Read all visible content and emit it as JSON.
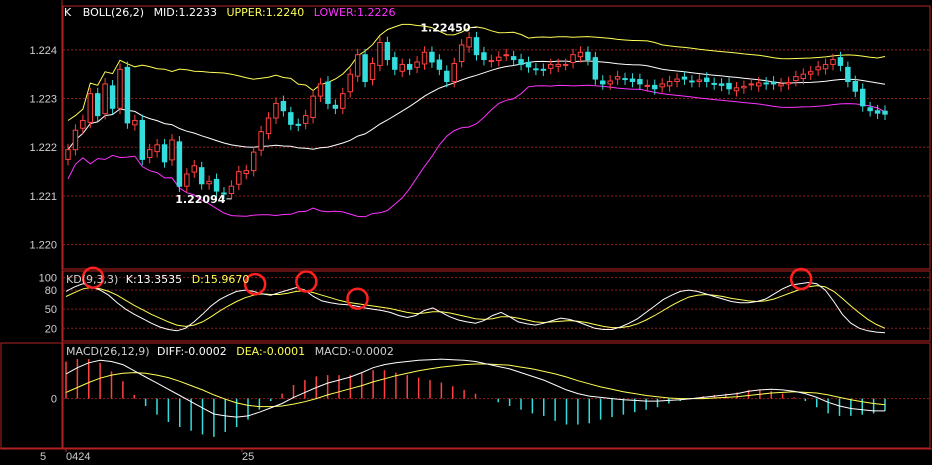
{
  "colors": {
    "background": "#000000",
    "frame": "#b22222",
    "grid": "#8b1a1a",
    "up": "#ff4040",
    "down": "#33dddd",
    "mid": "#ffffff",
    "upper": "#ffff55",
    "lower": "#ff33ff",
    "k": "#ffffff",
    "d": "#ffff55",
    "diff": "#ffffff",
    "dea": "#ffff55",
    "marker": "#ff2020"
  },
  "chart_data": [
    {
      "type": "candlestick",
      "panel": "price",
      "indicator": {
        "prefix": "K",
        "name": "BOLL(26,2)",
        "mid_label": "MID:",
        "mid_value": "1.2233",
        "upper_label": "UPPER:",
        "upper_value": "1.2240",
        "lower_label": "LOWER:",
        "lower_value": "1.2226"
      },
      "yticks": [
        "1.224",
        "1.223",
        "1.222",
        "1.221",
        "1.220"
      ],
      "ytick_values": [
        1.224,
        1.223,
        1.222,
        1.221,
        1.22
      ],
      "ylim": [
        1.2195,
        1.2249
      ],
      "annotations": [
        {
          "text": "1.22450",
          "x_index": 55,
          "value": 1.2245,
          "side": "left"
        },
        {
          "text": "1.22094",
          "x_index": 22,
          "value": 1.22094,
          "side": "left"
        }
      ],
      "closes": [
        1.22195,
        1.22235,
        1.22255,
        1.2231,
        1.22265,
        1.2233,
        1.2228,
        1.2236,
        1.2225,
        1.22255,
        1.22175,
        1.22195,
        1.22205,
        1.2217,
        1.22215,
        1.2212,
        1.22145,
        1.22162,
        1.22125,
        1.2213,
        1.2211,
        1.22105,
        1.2212,
        1.2215,
        1.22152,
        1.2219,
        1.22232,
        1.2226,
        1.2229,
        1.22275,
        1.22247,
        1.22245,
        1.22265,
        1.22305,
        1.2233,
        1.2229,
        1.2228,
        1.2231,
        1.2235,
        1.2239,
        1.22335,
        1.22372,
        1.22415,
        1.2238,
        1.2236,
        1.2237,
        1.2236,
        1.22375,
        1.22395,
        1.22375,
        1.2236,
        1.22335,
        1.22372,
        1.2241,
        1.22425,
        1.2239,
        1.2238,
        1.22378,
        1.22385,
        1.2239,
        1.2238,
        1.2237,
        1.22365,
        1.2236,
        1.22358,
        1.2237,
        1.2237,
        1.2237,
        1.2239,
        1.22395,
        1.2238,
        1.2234,
        1.2233,
        1.22336,
        1.22345,
        1.2234,
        1.22335,
        1.2233,
        1.22327,
        1.2232,
        1.2233,
        1.22335,
        1.2234,
        1.2234,
        1.22335,
        1.22338,
        1.22335,
        1.2233,
        1.22327,
        1.2232,
        1.22322,
        1.22325,
        1.2233,
        1.22332,
        1.2233,
        1.2233,
        1.2233,
        1.22333,
        1.22345,
        1.2235,
        1.22355,
        1.22365,
        1.2237,
        1.2238,
        1.22368,
        1.22335,
        1.22315,
        1.22285,
        1.22275,
        1.2227,
        1.22268
      ]
    },
    {
      "type": "line",
      "panel": "kd",
      "indicator": {
        "name": "KD(9,3,3)",
        "k_label": "K:",
        "k_value": "13.3535",
        "d_label": "D:",
        "d_value": "15.9670"
      },
      "yticks": [
        "100",
        "80",
        "50",
        "20"
      ],
      "ytick_values": [
        100,
        80,
        50,
        20
      ],
      "ylim": [
        0,
        110
      ],
      "k": [
        78,
        85,
        90,
        85,
        80,
        72,
        60,
        50,
        42,
        35,
        28,
        22,
        18,
        16,
        20,
        30,
        42,
        55,
        65,
        72,
        78,
        80,
        78,
        74,
        72,
        76,
        80,
        84,
        80,
        70,
        63,
        60,
        58,
        57,
        55,
        52,
        50,
        48,
        45,
        40,
        37,
        40,
        48,
        52,
        45,
        38,
        33,
        30,
        28,
        32,
        40,
        45,
        38,
        30,
        27,
        25,
        28,
        32,
        36,
        34,
        30,
        25,
        20,
        18,
        18,
        22,
        28,
        35,
        45,
        55,
        65,
        72,
        78,
        80,
        78,
        74,
        70,
        66,
        62,
        60,
        60,
        62,
        66,
        74,
        82,
        88,
        90,
        92,
        90,
        80,
        62,
        42,
        28,
        20,
        16,
        14,
        13
      ],
      "d": [
        70,
        76,
        82,
        84,
        82,
        78,
        72,
        64,
        56,
        49,
        42,
        36,
        30,
        25,
        23,
        25,
        30,
        38,
        47,
        55,
        62,
        68,
        72,
        74,
        73,
        73,
        75,
        78,
        79,
        76,
        72,
        68,
        64,
        61,
        59,
        57,
        55,
        53,
        51,
        48,
        45,
        43,
        44,
        46,
        46,
        44,
        41,
        38,
        35,
        34,
        35,
        38,
        38,
        36,
        33,
        30,
        29,
        30,
        31,
        32,
        31,
        29,
        26,
        23,
        21,
        21,
        23,
        27,
        33,
        40,
        48,
        56,
        63,
        69,
        72,
        73,
        72,
        70,
        67,
        65,
        63,
        62,
        63,
        66,
        71,
        76,
        81,
        85,
        87,
        85,
        78,
        67,
        55,
        44,
        34,
        26,
        20
      ]
    },
    {
      "type": "bar",
      "panel": "macd",
      "indicator": {
        "name": "MACD(26,12,9)",
        "diff_label": "DIFF:",
        "diff_value": "-0.0002",
        "dea_label": "DEA:",
        "dea_value": "-0.0001",
        "macd_label": "MACD:",
        "macd_value": "-0.0002"
      },
      "yticks": [
        "0"
      ],
      "ytick_values": [
        0
      ],
      "ylim": [
        -0.0008,
        0.0009
      ],
      "diff": [
        0.0004,
        0.0005,
        0.00058,
        0.00062,
        0.0006,
        0.00055,
        0.00045,
        0.00035,
        0.00025,
        0.00015,
        5e-05,
        -5e-05,
        -0.00015,
        -0.00025,
        -0.00028,
        -0.0003,
        -0.00028,
        -0.00022,
        -0.00015,
        -8e-05,
        2e-05,
        0.0001,
        0.00018,
        0.00025,
        0.0003,
        0.00035,
        0.00042,
        0.0005,
        0.00055,
        0.00058,
        0.0006,
        0.00062,
        0.00063,
        0.00064,
        0.00063,
        0.00062,
        0.0006,
        0.00056,
        0.00052,
        0.00048,
        0.00042,
        0.00036,
        0.0003,
        0.00022,
        0.00014,
        8e-05,
        4e-05,
        2e-05,
        0.0,
        -2e-05,
        -3e-05,
        -4e-05,
        -4e-05,
        -3e-05,
        -2e-05,
        0.0,
        2e-05,
        4e-05,
        6e-05,
        8e-05,
        0.00012,
        0.00014,
        0.00015,
        0.00014,
        0.00012,
        8e-05,
        2e-05,
        -6e-05,
        -0.00012,
        -0.00016,
        -0.00018,
        -0.0002,
        -0.0002
      ],
      "dea": [
        0.0001,
        0.00018,
        0.00026,
        0.00033,
        0.00038,
        0.00041,
        0.00042,
        0.00041,
        0.00038,
        0.00034,
        0.00028,
        0.00021,
        0.00014,
        6e-05,
        -1e-05,
        -7e-05,
        -0.00011,
        -0.00013,
        -0.00013,
        -0.00012,
        -9e-05,
        -5e-05,
        0.0,
        6e-05,
        0.00011,
        0.00016,
        0.00021,
        0.00027,
        0.00032,
        0.00037,
        0.00041,
        0.00045,
        0.00048,
        0.00051,
        0.00053,
        0.00055,
        0.00056,
        0.00056,
        0.00055,
        0.00054,
        0.00051,
        0.00048,
        0.00044,
        0.0004,
        0.00035,
        0.00029,
        0.00024,
        0.00019,
        0.00015,
        0.00011,
        8e-05,
        5e-05,
        3e-05,
        1e-05,
        0.0,
        0.0,
        0.0,
        1e-05,
        2e-05,
        3e-05,
        5e-05,
        7e-05,
        9e-05,
        0.0001,
        0.00011,
        0.0001,
        9e-05,
        6e-05,
        2e-05,
        -2e-05,
        -5e-05,
        -8e-05,
        -0.0001
      ],
      "hist_note": "MACD histogram = 2*(DIFF-DEA)"
    }
  ],
  "xaxis": {
    "left_box_text": "5",
    "labels": [
      {
        "text": "0424",
        "x_index": 0
      },
      {
        "text": "25",
        "x_index": 30
      }
    ]
  }
}
